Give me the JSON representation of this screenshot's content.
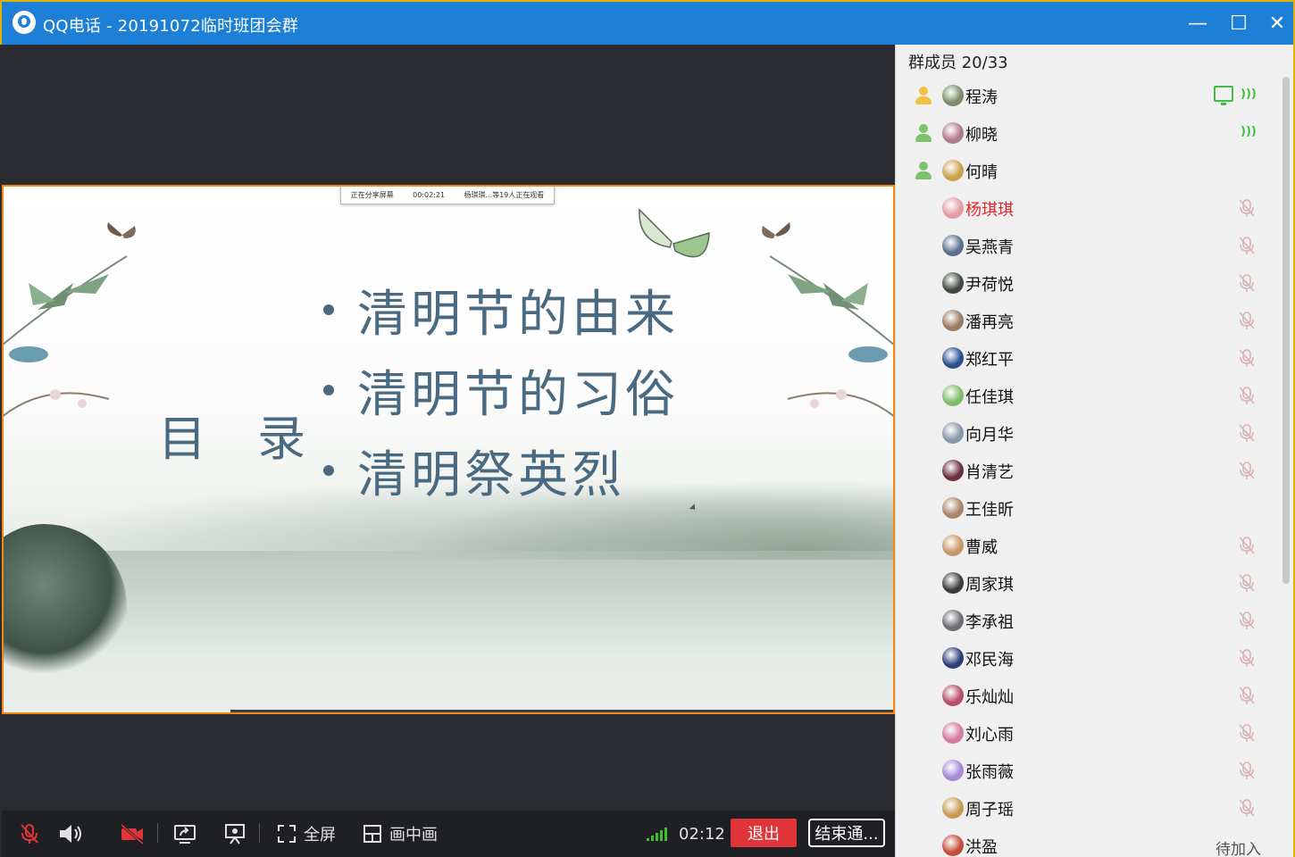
{
  "window": {
    "title": "QQ电话 - 20191072临时班团会群",
    "minimize_glyph": "—",
    "maximize_glyph": "☐",
    "close_glyph": "✕"
  },
  "share_bar": {
    "status": "正在分享屏幕",
    "timer": "00:02:21",
    "viewers": "杨琪琪...等19人正在观看"
  },
  "slide": {
    "heading": "目 录",
    "items": [
      "清明节的由来",
      "清明节的习俗",
      "清明祭英烈"
    ]
  },
  "toolbar": {
    "fullscreen_label": "全屏",
    "pip_label": "画中画",
    "call_time": "02:12",
    "exit_label": "退出",
    "end_label": "结束通..."
  },
  "panel": {
    "header": "群成员 20/33",
    "members": [
      {
        "name": "程涛",
        "host": "yellow",
        "status": "screen-speaking",
        "avatar_color": "#7a8c6a"
      },
      {
        "name": "柳晓",
        "host": "green",
        "status": "speaking",
        "avatar_color": "#b0798e"
      },
      {
        "name": "何晴",
        "host": "green",
        "status": "none",
        "avatar_color": "#c9a24f"
      },
      {
        "name": "杨琪琪",
        "host": "",
        "status": "muted",
        "avatar_color": "#e39aa3",
        "highlight": true
      },
      {
        "name": "吴燕青",
        "host": "",
        "status": "muted",
        "avatar_color": "#5a6f8c"
      },
      {
        "name": "尹荷悦",
        "host": "",
        "status": "muted",
        "avatar_color": "#3d4a3f"
      },
      {
        "name": "潘再亮",
        "host": "",
        "status": "muted",
        "avatar_color": "#9b7a61"
      },
      {
        "name": "郑红平",
        "host": "",
        "status": "muted",
        "avatar_color": "#2b4e8f"
      },
      {
        "name": "任佳琪",
        "host": "",
        "status": "muted",
        "avatar_color": "#7dbb6a"
      },
      {
        "name": "向月华",
        "host": "",
        "status": "muted",
        "avatar_color": "#8796a8"
      },
      {
        "name": "肖清艺",
        "host": "",
        "status": "muted",
        "avatar_color": "#6a2f3f"
      },
      {
        "name": "王佳昕",
        "host": "",
        "status": "none",
        "avatar_color": "#a9846a"
      },
      {
        "name": "曹威",
        "host": "",
        "status": "muted",
        "avatar_color": "#c79666"
      },
      {
        "name": "周家琪",
        "host": "",
        "status": "muted",
        "avatar_color": "#3b3b3b"
      },
      {
        "name": "李承祖",
        "host": "",
        "status": "muted",
        "avatar_color": "#6d6d75"
      },
      {
        "name": "邓民海",
        "host": "",
        "status": "muted",
        "avatar_color": "#2c3f7a"
      },
      {
        "name": "乐灿灿",
        "host": "",
        "status": "muted",
        "avatar_color": "#b54e6a"
      },
      {
        "name": "刘心雨",
        "host": "",
        "status": "muted",
        "avatar_color": "#d27aa0"
      },
      {
        "name": "张雨薇",
        "host": "",
        "status": "muted",
        "avatar_color": "#a58bd6"
      },
      {
        "name": "周子瑶",
        "host": "",
        "status": "muted",
        "avatar_color": "#c89b55"
      },
      {
        "name": "洪盈",
        "host": "",
        "status": "pending",
        "avatar_color": "#c44c3a"
      }
    ],
    "pending_label": "待加入"
  },
  "colors": {
    "titlebar": "#1e7fd6",
    "accent_green": "#3ebf3e",
    "exit_red": "#e1353a",
    "slide_text": "#4a6a82",
    "highlight_name": "#e0282d"
  }
}
